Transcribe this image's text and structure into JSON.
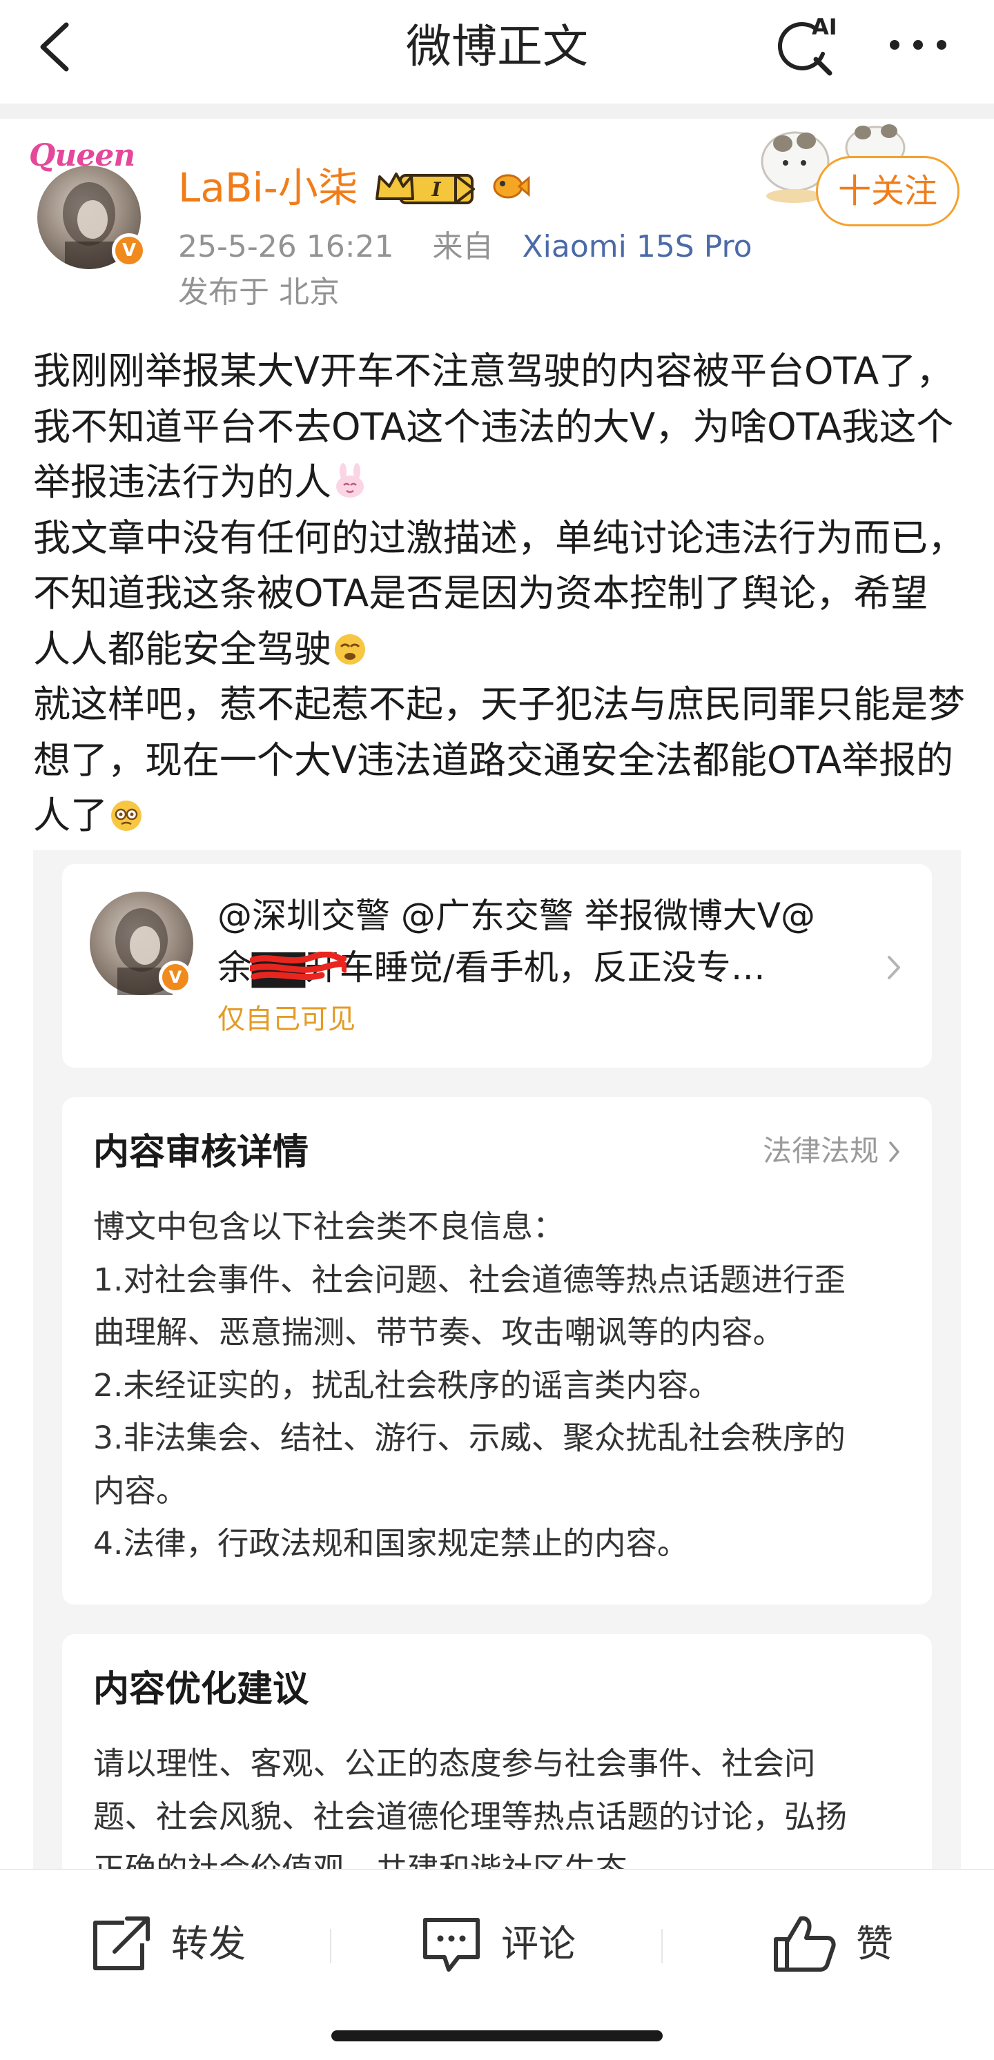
{
  "nav": {
    "title": "微博正文"
  },
  "author": {
    "avatar_tag": "Queen",
    "name": "LaBi-小柒",
    "vip_level": "I",
    "time": "25-5-26 16:21",
    "from_label": "来自",
    "device": "Xiaomi 15S Pro",
    "location": "发布于 北京",
    "follow_label": "十关注"
  },
  "post": {
    "p1": "我刚刚举报某大V开车不注意驾驶的内容被平台OTA了，我不知道平台不去OTA这个违法的大V，为啥OTA我这个举报违法行为的人",
    "p2": "我文章中没有任何的过激描述，单纯讨论违法行为而已，不知道我这条被OTA是否是因为资本控制了舆论，希望人人都能安全驾驶",
    "p3": "就这样吧，惹不起惹不起，天子犯法与庶民同罪只能是梦想了，现在一个大V违法道路交通安全法都能OTA举报的人了"
  },
  "referenced": {
    "line1": "@深圳交警 @广东交警 举报微博大V@",
    "line2": "余▇▇开车睡觉/看手机，反正没专…",
    "visibility": "仅自己可见"
  },
  "audit": {
    "title": "内容审核详情",
    "link": "法律法规",
    "lines": [
      "博文中包含以下社会类不良信息：",
      "1.对社会事件、社会问题、社会道德等热点话题进行歪",
      "曲理解、恶意揣测、带节奏、攻击嘲讽等的内容。",
      "2.未经证实的，扰乱社会秩序的谣言类内容。",
      "3.非法集会、结社、游行、示威、聚众扰乱社会秩序的",
      "内容。",
      "4.法律，行政法规和国家规定禁止的内容。"
    ]
  },
  "suggestion": {
    "title": "内容优化建议",
    "lines": [
      "请以理性、客观、公正的态度参与社会事件、社会问",
      "题、社会风貌、社会道德伦理等热点话题的讨论，弘扬",
      "正确的社会价值观，共建和谐社区生态。"
    ]
  },
  "bottom": {
    "repost": "转发",
    "comment": "评论",
    "like": "赞"
  },
  "colors": {
    "accent": "#f07d19",
    "link": "#4b6aa8",
    "muted": "#939393",
    "visibility": "#e49b26"
  },
  "icons": [
    "back-icon",
    "ai-search-icon",
    "more-icon",
    "verified-icon",
    "vip-crown-icon",
    "fish-icon",
    "chevron-right-icon",
    "repost-icon",
    "comment-icon",
    "like-icon"
  ]
}
